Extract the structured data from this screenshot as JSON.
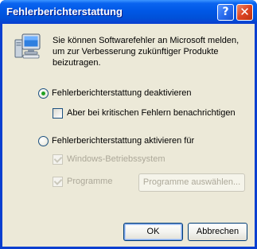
{
  "window": {
    "title": "Fehlerberichterstattung",
    "help_glyph": "?",
    "close_glyph": "✕"
  },
  "intro_text": "Sie können Softwarefehler an Microsoft melden, um zur Verbesserung zukünftiger Produkte beizutragen.",
  "options": {
    "deactivate": {
      "label": "Fehlerberichterstattung deaktivieren",
      "checked": true
    },
    "notify_critical": {
      "label": "Aber bei kritischen Fehlern benachrichtigen",
      "checked": false
    },
    "activate": {
      "label": "Fehlerberichterstattung aktivieren für",
      "checked": false
    },
    "windows_os": {
      "label": "Windows-Betriebssystem",
      "checked": true,
      "disabled": true
    },
    "programs": {
      "label": "Programme",
      "checked": true,
      "disabled": true
    }
  },
  "buttons": {
    "choose_programs": "Programme auswählen...",
    "ok": "OK",
    "cancel": "Abbrechen"
  },
  "icons": {
    "dialog": "computer-monitor-icon",
    "help": "help-icon",
    "close": "close-icon"
  },
  "colors": {
    "titlebar": "#0058e6",
    "dialog_background": "#ece9d8",
    "radio_check": "#21a121",
    "disabled_text": "#aca899"
  }
}
